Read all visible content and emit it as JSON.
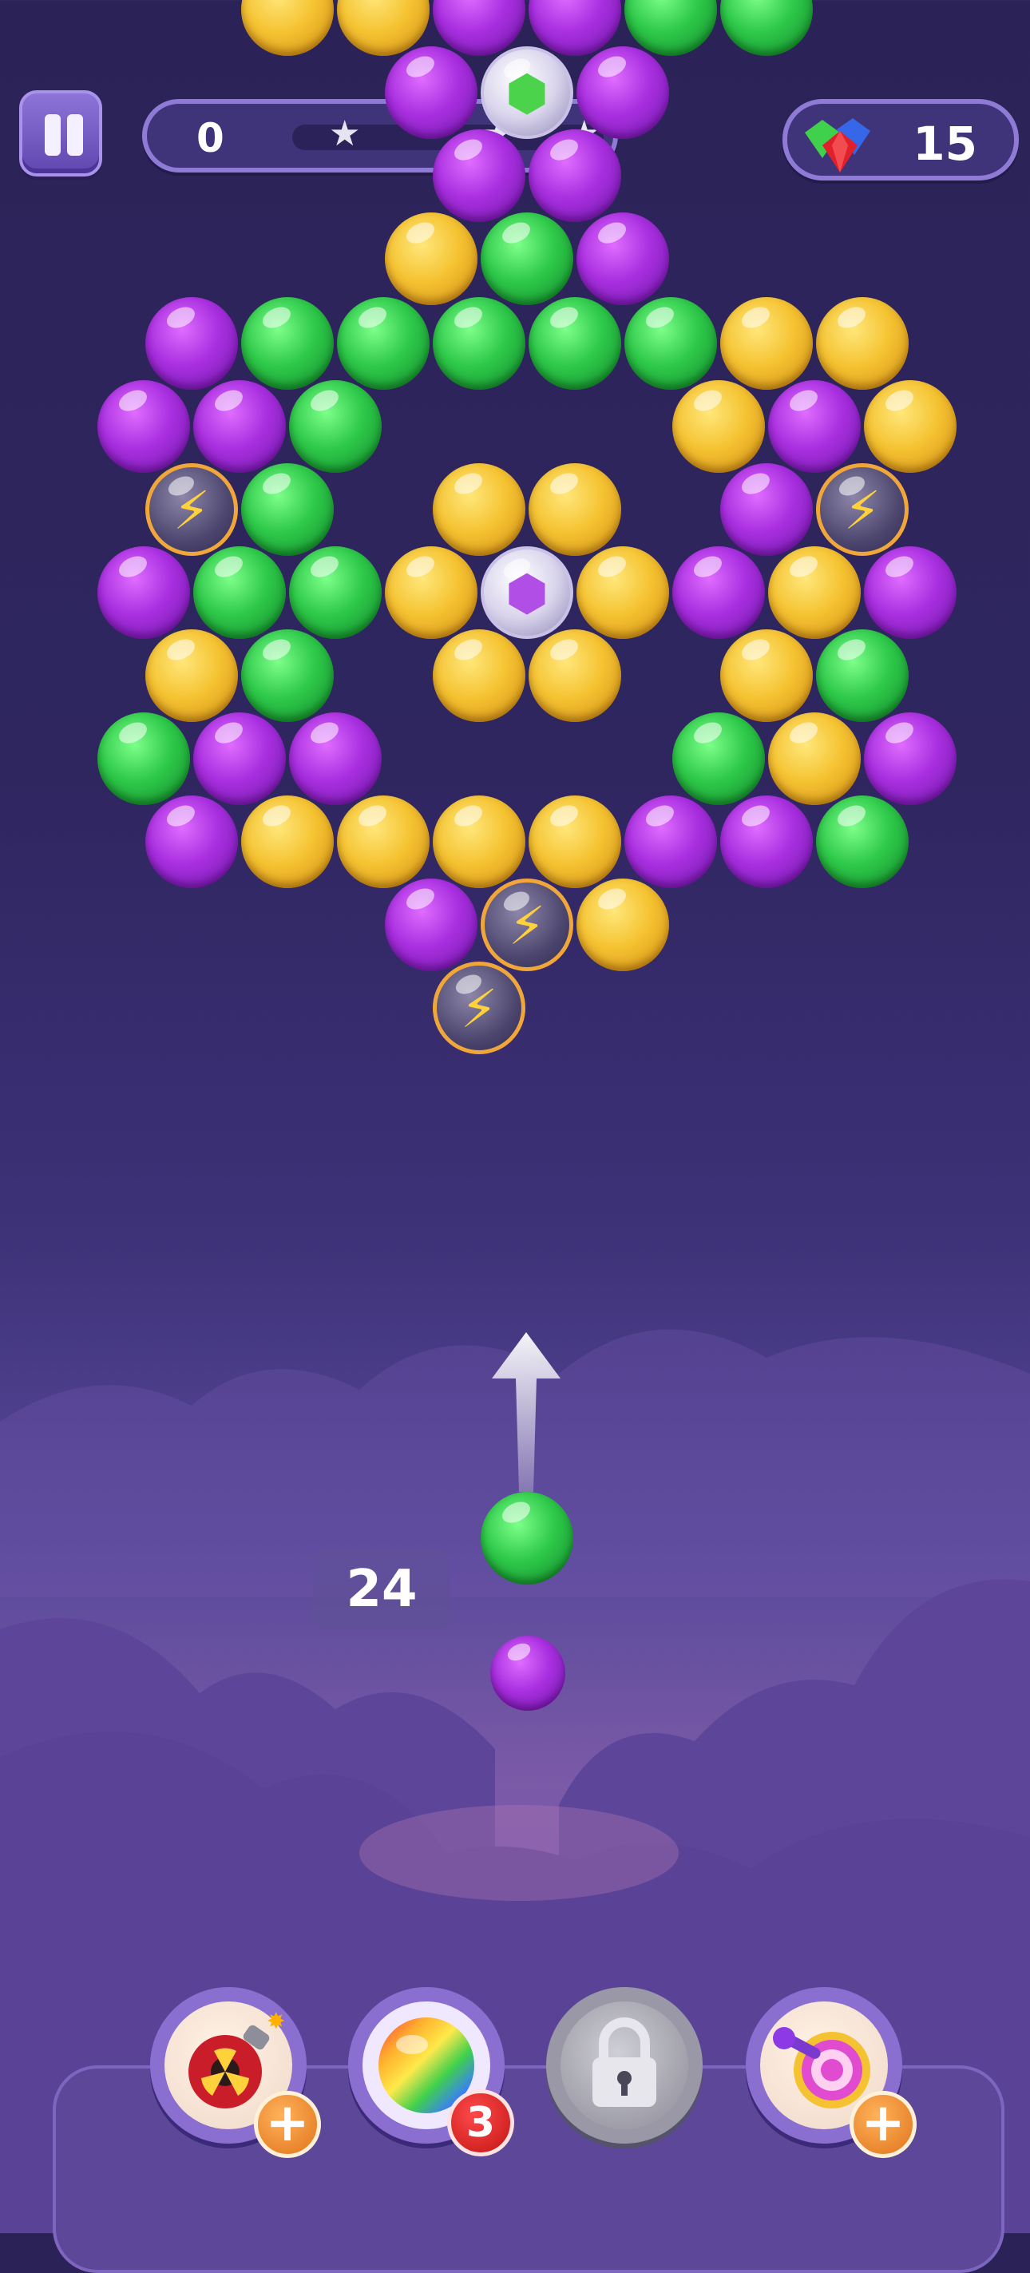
{
  "hud": {
    "score": "0",
    "stars_total": 3,
    "stars_earned": 0,
    "gem_count": "15"
  },
  "shooter": {
    "moves_left": "24",
    "current_bubble": "green",
    "next_bubble": "purple"
  },
  "boosters": [
    {
      "name": "bomb-booster",
      "badge": "+"
    },
    {
      "name": "rainbow-booster",
      "badge": "3"
    },
    {
      "name": "locked-booster",
      "badge": ""
    },
    {
      "name": "target-booster",
      "badge": "+"
    }
  ],
  "colors": {
    "purple": "#a92fe0",
    "green": "#2ec94a",
    "yellow": "#f5c332",
    "bolt_ring": "#f1a63a",
    "panel": "#3f3479"
  }
}
